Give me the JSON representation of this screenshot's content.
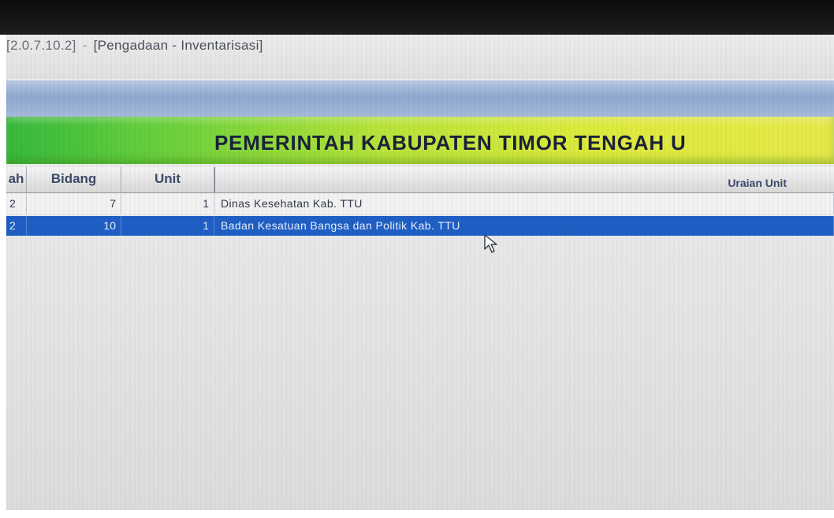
{
  "window": {
    "version": "[2.0.7.10.2]",
    "separator": "-",
    "title": "[Pengadaan - Inventarisasi]"
  },
  "banner": {
    "title": "PEMERINTAH KABUPATEN TIMOR TENGAH U"
  },
  "table": {
    "headers": [
      "ah",
      "Bidang",
      "Unit",
      "Uraian Unit"
    ],
    "rows": [
      {
        "col0": "2",
        "bidang": "7",
        "unit": "1",
        "uraian": "Dinas Kesehatan Kab. TTU",
        "selected": false
      },
      {
        "col0": "2",
        "bidang": "10",
        "unit": "1",
        "uraian": "Badan Kesatuan Bangsa dan Politik Kab. TTU",
        "selected": true
      }
    ]
  },
  "icons": {
    "cursor": "mouse-pointer-icon"
  },
  "colors": {
    "selected_row": "#1f5fc4",
    "banner_green": "#67cf3c",
    "banner_yellow": "#e6ea4a",
    "header_band": "#8ea8d0"
  }
}
